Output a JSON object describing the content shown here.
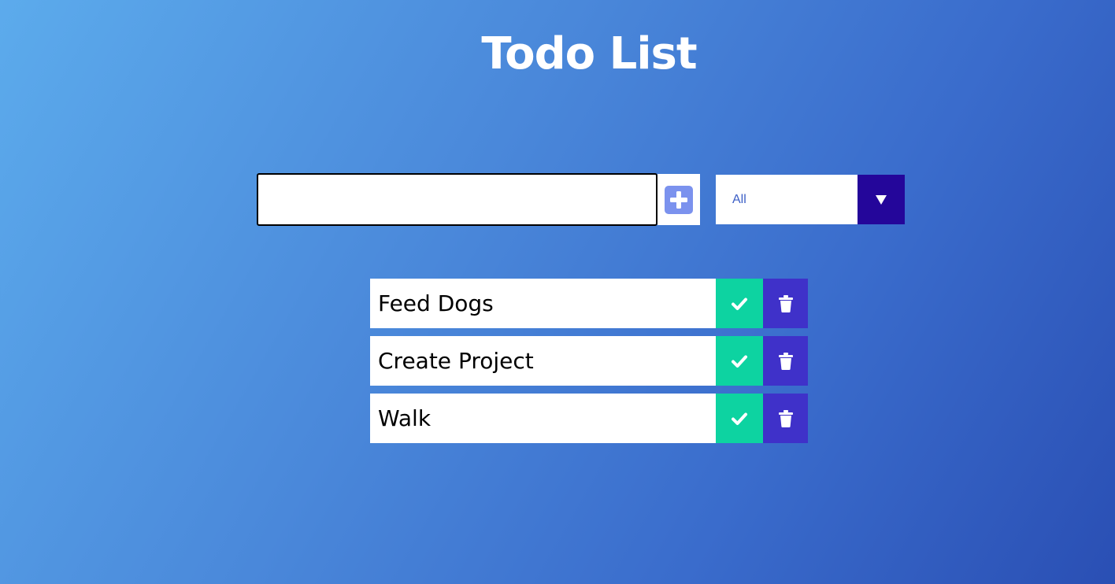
{
  "title": "Todo List",
  "input": {
    "value": "",
    "placeholder": ""
  },
  "add_button": {
    "icon": "plus-square-icon",
    "color": "#7b92ee"
  },
  "filter": {
    "selected": "All",
    "arrow_icon": "triangle-down-icon",
    "accent": "#24069a"
  },
  "todos": [
    {
      "text": "Feed Dogs",
      "complete_icon": "check-icon",
      "delete_icon": "trash-icon"
    },
    {
      "text": "Create Project",
      "complete_icon": "check-icon",
      "delete_icon": "trash-icon"
    },
    {
      "text": "Walk",
      "complete_icon": "check-icon",
      "delete_icon": "trash-icon"
    }
  ],
  "colors": {
    "complete": "#0dd3a1",
    "delete": "#3f31c9",
    "background_start": "#5cabec",
    "background_end": "#2a4fb4"
  }
}
